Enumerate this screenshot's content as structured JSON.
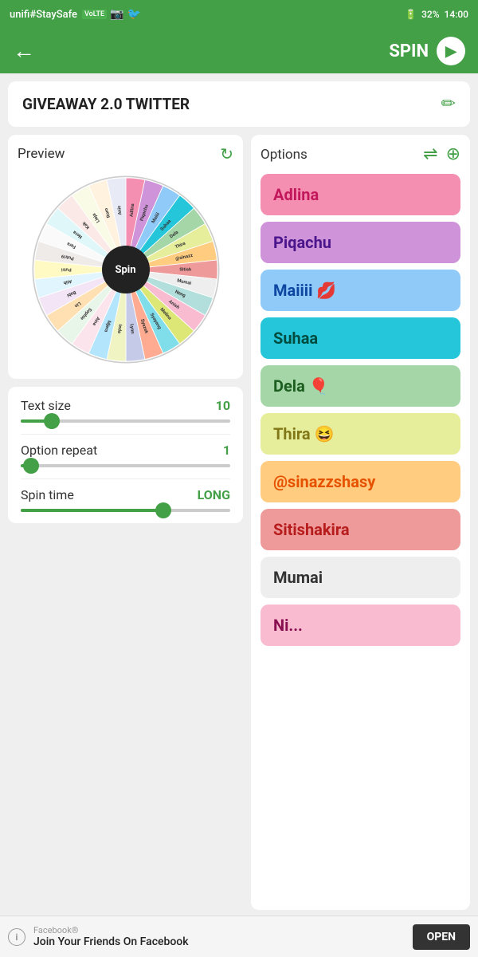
{
  "statusBar": {
    "carrier": "unifi#StaySafe",
    "volte": "VoLTE",
    "battery": "32%",
    "time": "14:00"
  },
  "topBar": {
    "backLabel": "←",
    "spinLabel": "SPIN",
    "spinIcon": "▶"
  },
  "titleCard": {
    "title": "GIVEAWAY 2.0 TWITTER",
    "editIcon": "✏"
  },
  "preview": {
    "label": "Preview",
    "refreshIcon": "⟳"
  },
  "controls": {
    "textSize": {
      "label": "Text size",
      "value": "10",
      "thumbPercent": 15
    },
    "optionRepeat": {
      "label": "Option repeat",
      "value": "1",
      "thumbPercent": 5
    },
    "spinTime": {
      "label": "Spin time",
      "value": "LONG",
      "thumbPercent": 68
    }
  },
  "options": {
    "label": "Options",
    "shuffleIcon": "⇌",
    "addIcon": "⊕",
    "items": [
      {
        "text": "Adlina",
        "bg": "#f48fb1",
        "color": "#c2185b"
      },
      {
        "text": "Piqachu",
        "bg": "#ce93d8",
        "color": "#4a148c"
      },
      {
        "text": "Maiiii 💋",
        "bg": "#90caf9",
        "color": "#0d47a1"
      },
      {
        "text": "Suhaa",
        "bg": "#26c6da",
        "color": "#004d40"
      },
      {
        "text": "Dela 🎈",
        "bg": "#a5d6a7",
        "color": "#1b5e20"
      },
      {
        "text": "Thira 😆",
        "bg": "#e6ee9c",
        "color": "#827717"
      },
      {
        "text": "@sinazzshasy",
        "bg": "#ffcc80",
        "color": "#e65100"
      },
      {
        "text": "Sitishakira",
        "bg": "#ef9a9a",
        "color": "#b71c1c"
      },
      {
        "text": "Mumai",
        "bg": "#eeeeee",
        "color": "#333333"
      },
      {
        "text": "Ni...",
        "bg": "#f8bbd0",
        "color": "#880e4f"
      }
    ]
  },
  "wheel": {
    "centerLabel": "Spin",
    "segments": [
      {
        "color": "#f48fb1",
        "label": "Adlina"
      },
      {
        "color": "#ce93d8",
        "label": "Piqachu"
      },
      {
        "color": "#90caf9",
        "label": "Maiiii"
      },
      {
        "color": "#26c6da",
        "label": "Suhaa"
      },
      {
        "color": "#a5d6a7",
        "label": "Dela"
      },
      {
        "color": "#e6ee9c",
        "label": "Thira"
      },
      {
        "color": "#ffcc80",
        "label": "@sinazz"
      },
      {
        "color": "#ef9a9a",
        "label": "Sitish"
      },
      {
        "color": "#eeeeee",
        "label": "Mumai"
      },
      {
        "color": "#b2dfdb",
        "label": "Neng"
      },
      {
        "color": "#f8bbd0",
        "label": "Anish"
      },
      {
        "color": "#dce775",
        "label": "Melina"
      },
      {
        "color": "#80deea",
        "label": "Syayang"
      },
      {
        "color": "#ffab91",
        "label": "Syazek"
      },
      {
        "color": "#c5cae9",
        "label": "Lynn"
      },
      {
        "color": "#f0f4c3",
        "label": "Inda"
      },
      {
        "color": "#b3e5fc",
        "label": "Mjera"
      },
      {
        "color": "#fce4ec",
        "label": "Aina"
      },
      {
        "color": "#e8f5e9",
        "label": "Sophie"
      },
      {
        "color": "#ffe0b2",
        "label": "Lin"
      },
      {
        "color": "#f3e5f5",
        "label": "Babi"
      },
      {
        "color": "#e1f5fe",
        "label": "Atih"
      },
      {
        "color": "#fff9c4",
        "label": "Putri"
      },
      {
        "color": "#efebe9",
        "label": "Putri9"
      },
      {
        "color": "#fafafa",
        "label": "Fara"
      },
      {
        "color": "#e0f7fa",
        "label": "Nora"
      },
      {
        "color": "#fbe9e7",
        "label": "Kak"
      },
      {
        "color": "#f9fbe7",
        "label": "Lieja"
      },
      {
        "color": "#fff3e0",
        "label": "Roro"
      },
      {
        "color": "#e8eaf6",
        "label": "Anis"
      }
    ]
  },
  "ad": {
    "source": "Facebook®",
    "message": "Join Your Friends On Facebook",
    "openLabel": "OPEN",
    "infoIcon": "i"
  }
}
